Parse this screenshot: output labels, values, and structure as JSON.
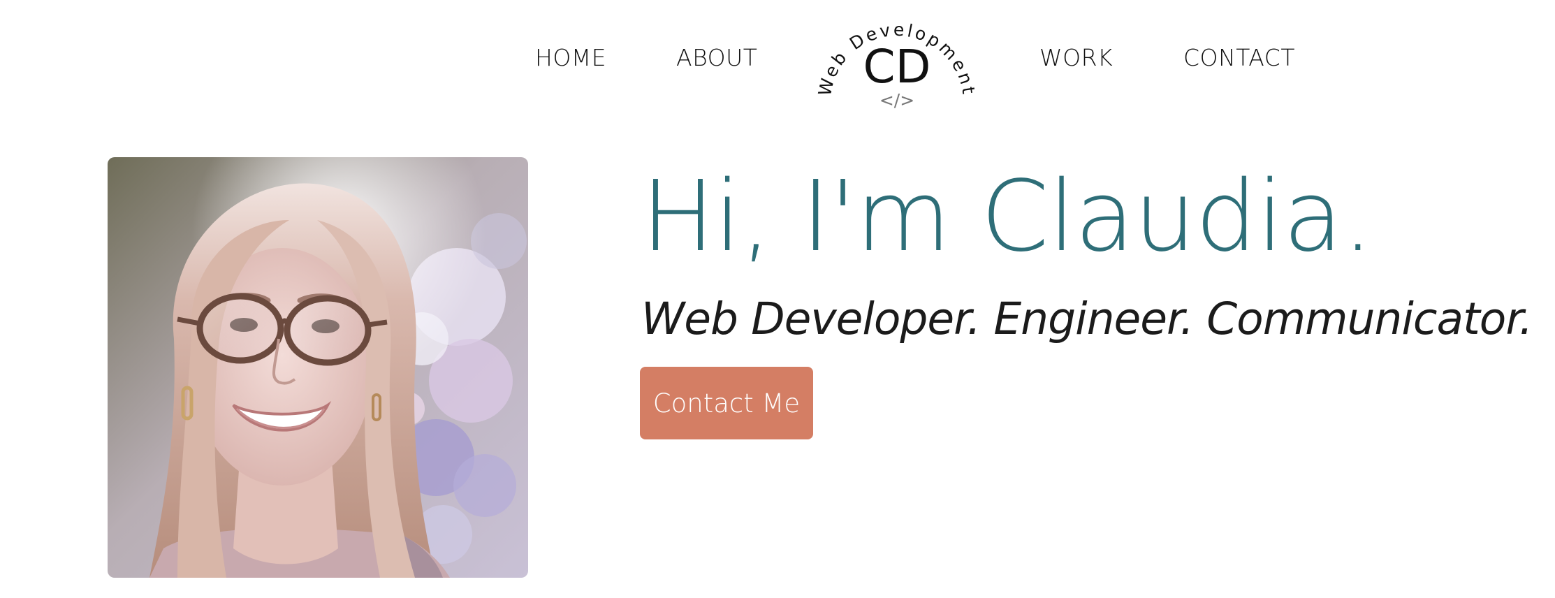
{
  "nav": {
    "items": [
      {
        "label": "HOME"
      },
      {
        "label": "ABOUT"
      },
      {
        "label": "WORK"
      },
      {
        "label": "CONTACT"
      }
    ]
  },
  "logo": {
    "arc_text": "Web Development",
    "monogram": "CD",
    "code_glyph": "</>"
  },
  "hero": {
    "title": "Hi, I'm Claudia.",
    "subtitle": "Web Developer. Engineer. Communicator.",
    "cta_label": "Contact Me"
  },
  "colors": {
    "title": "#2e6e78",
    "button": "#d47e64",
    "text": "#111111",
    "background": "#ffffff"
  }
}
